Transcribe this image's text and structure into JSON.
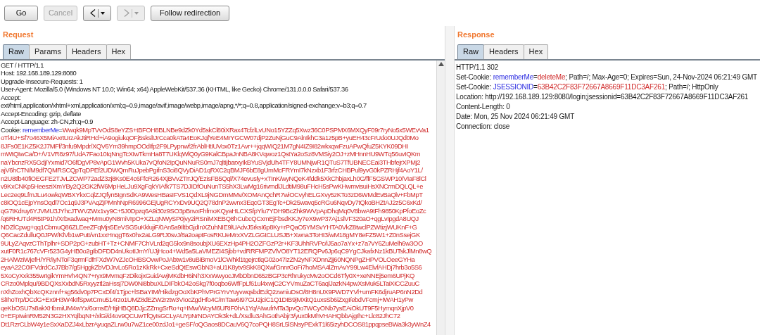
{
  "toolbar": [
    {
      "kind": "text",
      "label": "Go",
      "disabled": false
    },
    {
      "kind": "text",
      "label": "Cancel",
      "disabled": true
    },
    {
      "kind": "back",
      "disabled": false
    },
    {
      "kind": "forward",
      "disabled": true
    },
    {
      "kind": "text",
      "label": "Follow redirection",
      "disabled": false
    }
  ],
  "request": {
    "title": "Request",
    "tabs": [
      {
        "label": "Raw",
        "selected": true
      },
      {
        "label": "Params",
        "selected": false
      },
      {
        "label": "Headers",
        "selected": false
      },
      {
        "label": "Hex",
        "selected": false
      }
    ],
    "lines": [
      [
        {
          "kind": "plain",
          "text": "GET / HTTP/1.1"
        }
      ],
      [
        {
          "kind": "plain",
          "text": "Host: 192.168.189.129:8080"
        }
      ],
      [
        {
          "kind": "plain",
          "text": "Upgrade-Insecure-Requests: 1"
        }
      ],
      [
        {
          "kind": "plain",
          "text": "User-Agent: Mozilla/5.0 (Windows NT 10.0; Win64; x64) AppleWebKit/537.36 (KHTML, like Gecko) Chrome/131.0.0.0 Safari/537.36"
        }
      ],
      [
        {
          "kind": "plain",
          "text": "Accept:"
        }
      ],
      [
        {
          "kind": "plain",
          "text": "ext/html,application/xhtml+xml,application/xml;q=0.9,image/avif,image/webp,image/apng,*/*;q=0.8,application/signed-exchange;v=b3;q=0.7"
        }
      ],
      [
        {
          "kind": "plain",
          "text": "Accept-Encoding: gzip, deflate"
        }
      ],
      [
        {
          "kind": "plain",
          "text": "Accept-Language: zh-CN,zh;q=0.9"
        }
      ],
      [
        {
          "kind": "plain",
          "text": "Cookie: "
        },
        {
          "kind": "name",
          "text": "rememberMe"
        },
        {
          "kind": "plain",
          "text": "="
        },
        {
          "kind": "value",
          "text": "Wwqk9MpTVvOdS8eYZS+tBFOH8BLNBe9dZk0Yd5skCl80iXRax4TcfzlLvUNo15YZZq5Xwz36C0PSPMX6MXQyF09r7ryNo5x5WEvVa1"
        }
      ],
      [
        {
          "kind": "value",
          "text": "oTl4U+Sf7o46X5MiAxrtUrzAkJtiRHcl+iA9ogiukqOFj5skslIJrCca0kATa4EoKJqfYeE4MrYGCW07djP2ZuNjGuC9AlnIkhC3a1z5pB+yuEH43cFrUdo0UJQd0Mo"
        }
      ],
      [
        {
          "kind": "value",
          "text": "8JFs0E1KZ5K2J7MFf/3nfu9Mpdr/XQV6Ym39hmpOOdIfp2F9LPypnwf2frAblHtIUVox0Tz1Avr++jqqWIQ21M7gN4IZ9I82wkxqwFzuAPwQfuZ5KYK09DHI"
        }
      ],
      [
        {
          "kind": "value",
          "text": "mWtQIwCa/D+/V1VR8z97/UdA7Fao10IqNngTcXIwTkmHa8T7UKlqWlQ0yG9KalCBpaJnNBA8KVqwoz1QstYa2oSz8VMSiy2OJ+zMHnnHU9WTq56uvIQKm"
        }
      ],
      [
        {
          "kind": "value",
          "text": "naYbcnzRX5Gdj/Yxmid7O6fDgVP8vApG1Wvh5KUka7vQfoN2IpQuNNuRS0mJ7qltIjbarxyIkBYuSVjdUh4TFY8UMNjwR1QTuS7TfUBNECEai3THbfejrXPMj2"
        }
      ],
      [
        {
          "kind": "value",
          "text": "ajV6hCTN/M9df7QMRSCQpTqDPEf2UDWQmRuJpebPgifnS3ci8QVyDiAD1qRXC2qBMJF6bE8gUmMcFRYmI7kNzxb1F3rfzCHBPul9yvG0kPZRHjf4AoY1L/"
        }
      ],
      [
        {
          "kind": "value",
          "text": "n2U8tlb40fiOEGFE2TJvLZCWP72adZ3zj8Ks0E4c6FfcR264XjBVvZTrrJQ/EzisFB5Qql/X74evusly+xTInK/wyNQeK4fddk5XkChbjaxLh0G/flF5GSWP10/VIaF8lCl"
        }
      ],
      [
        {
          "kind": "value",
          "text": "v9KxCNKp5HeesziXmYBy2Q2GK2fW6MpHeLJu9XgFqkYIAfk7TS7DJIDfOuNunTS5hX3LwMg16rivmdlJLdtiM98uFHcH5sPwKHwmvisuiHsXNCrmDQLQL+e"
        }
      ],
      [
        {
          "kind": "value",
          "text": "Lec2eq9LfrnJLu4owkqWBXYkxCqlZJQfyn5IgnSdKA9WesHBasIFVS1QdXL9jNGDmMMv/XOMAnQchR7wiOCvyhELGXvy5zKTo3zD6WMdEvBaQlv+FbMpT"
        }
      ],
      [
        {
          "kind": "value",
          "text": "c8iOQ1cEjpYnsOqdl7Oc1q9J3PVAqZjPMnhNpR6996GEjUgRCYxDv9UQ2Q78dnP2wvnx3EqcGT3EgTc+Dk25wavq5cRGu6NqvDy7tQkoBHZtAJ2z5C6xKd/"
        }
      ],
      [
        {
          "kind": "value",
          "text": "qG7tKdruy6YJVMU3JYhcJTWVZWx1vy9C+5J0Dpzq6A9i30z9SO3pBnvxFhfmoKQyaHLCXSfpYlu7YDH9BcZhk9WVpApDhqMq0V8bwA9tFh9850KpPfoEoZc"
        }
      ],
      [
        {
          "kind": "value",
          "text": "/q6RHUTd4R5tP91h/Xrbxadwaq+Mmu0yN8miVrpO+XZLqNWySP0jvy2iRSniMXEBQ8hCubcQCxmEjFbsdKKJy7eX9wP37Aj1slVF320aO+qgLvIpgdA8UQJ"
        }
      ],
      [
        {
          "kind": "value",
          "text": "NDZlCpwg+qq1CbmuQ86ZLEeeZFqMjs5EeVSG5uKklujiF/0An5a9IltbGjdInXZuhNIE9lUAdvJ5rksI6p8Ky+rPQaO5YMSvYHTA0VkZ8twclPZWtizjWUKnF+G"
        }
      ],
      [
        {
          "kind": "value",
          "text": "Q6CacZdulluQ0JPW/KlVb1wPutt/vn1xxHnqgT6x0hx2aLG9RJ0svJ/8a2oaptFosRKUeMrxXVZLGGtCLUSJB+Xwna3ToHI3/wM18gMY8eFZ5W1+Z0nSsejGK"
        }
      ],
      [
        {
          "kind": "value",
          "text": "9ULyZAqvzCThTplhr+SDP2pG+zubHT+Tz+CNMF7ChVLrd2qG5kx9n8soubjXU6EXzHp4PH2OZFGzP2r+KF3UhhRVPc/iJ5ao7aYx+z7a7vY6ZuMelh6w3OO"
        }
      ],
      [
        {
          "kind": "value",
          "text": "xutF0R1c767cVFr523G4yHB0o2gIbDFDD4nUkotIJmY/UJjHco4+Wd5a5LaVMEZI4Sjbb+vdRRFMPZVlVO8YT12ERQPv6Jp6qC9YgCJkafxNz1kBUTskJlMn8wQ"
        }
      ],
      [
        {
          "kind": "value",
          "text": "2HAlWziWjefH/YR/iyNToF3qrmFdfrFXdW7vZJcOHBSOvwPoJAbtw1v8uBiBmoV1lCWhkl1tgejrctlqG02o47izZN2yNFXDnnZjj60NQNPgZHPVOLOeeGYHa"
        }
      ],
      [
        {
          "kind": "value",
          "text": "eyaA22C0IFVdrdCcJ7Bb7/g5HggkZbVDJrvLo5Ro1zKkRk+CxeSdQtEswGbN3+aU1K8ytv9SkK8QXwfGnnrGoFi7hoMSA4lZmAvY99Lw4ElvfAHDj7hrb3o5S6"
        }
      ],
      [
        {
          "kind": "value",
          "text": "5XoCyXxk355wrIgikYmHvh4QN7+ryx9MvmqFzDikojxGuidAwjMKdbH6iNh3XxWwyocJMbDbnD65zBGP3cRhrukycMv2oOCd6Tfy0X+xeNNEj5em6UPjKQ"
        }
      ],
      [
        {
          "kind": "value",
          "text": "CRzo0Mplqu/9BDQXsXxbdN5Rxyyztl2aHssj7DW0Ni8bbuXLDIFbkO42oSkg7f0oqbo6WfFpLf61ul4xwjC2CYVmuZaCT6aqlJazkN4pwXsMuk5LTaiXiCCZuuC"
        }
      ],
      [
        {
          "kind": "value",
          "text": "nXhZoxhQbXcQKznnf+sg56dv0p7PCxDf4/1Tjpc+lSBaYIM/HikdzgOoXbKPhVPrGYrvYuyvwqsbdEdQ2zwniuDsO/8H8nUX9PWD7YVl+umFK6djruAP6nN2Dd"
        }
      ],
      [
        {
          "kind": "value",
          "text": "SlIhoTrp/DCdG+Ex9H3W4kIfSpwtCmu514rzo1UMZ8dEZW2rztw3VIocZgdHfo4C/mTaw6I97GU2jciC1Q1DIB9jMXitQ1uxsSb6iZxgI/ebdVFcmj+IWAH1yPw"
        }
      ],
      [
        {
          "kind": "value",
          "text": "qeKbOSU7s8akXHbmiUM4wYx/6omsE/HtjiHBQ8DJjcZZmgSrRo+q+IMw/WcyM6URIF0hA1Yq/AIwufrMTa3pvQo7WCyONb7ysEAiOkUT9F5HymqnXjpV0"
        }
      ],
      [
        {
          "kind": "value",
          "text": "0+EFpIwinRM52N3G2HXYqlbqNI+/xlGi/d4ov9QCUwTfQyIsGCLyAUYpNrNDAYOk3k+dL/Xsdlu3AhGothAbjr3/yux0kMhVHAHQbbAjgIhc+Llc82JhC72"
        }
      ],
      [
        {
          "kind": "value",
          "text": "Dt1RzrCLbW4y1eSxXaDZJ4xLbzrAyuqaZLrw0u7wZ1ce00zdJo1+geSF/oQGaos8DCauV6Q7coPQH8SrL5lSNsyPExkT1l65izyhDCOS81ppqpseBWa3k3yWnZ4"
        }
      ]
    ]
  },
  "response": {
    "title": "Response",
    "tabs": [
      {
        "label": "Raw",
        "selected": true
      },
      {
        "label": "Headers",
        "selected": false
      },
      {
        "label": "Hex",
        "selected": false
      }
    ],
    "lines": [
      [
        {
          "kind": "plain",
          "text": "HTTP/1.1 302"
        }
      ],
      [
        {
          "kind": "plain",
          "text": "Set-Cookie: "
        },
        {
          "kind": "name",
          "text": "rememberMe"
        },
        {
          "kind": "plain",
          "text": "="
        },
        {
          "kind": "value",
          "text": "deleteMe"
        },
        {
          "kind": "plain",
          "text": "; Path=/; Max-Age=0; Expires=Sun, 24-Nov-2024 06:21:49 GMT"
        }
      ],
      [
        {
          "kind": "plain",
          "text": "Set-Cookie: "
        },
        {
          "kind": "name",
          "text": "JSESSIONID"
        },
        {
          "kind": "plain",
          "text": "="
        },
        {
          "kind": "value",
          "text": "63B42C2F83F72667A8669F11DC3AF261"
        },
        {
          "kind": "plain",
          "text": "; Path=/; HttpOnly"
        }
      ],
      [
        {
          "kind": "plain",
          "text": "Location: http://192.168.189.129:8080/login;jsessionid=63B42C2F83F72667A8669F11DC3AF261"
        }
      ],
      [
        {
          "kind": "plain",
          "text": "Content-Length: 0"
        }
      ],
      [
        {
          "kind": "plain",
          "text": "Date: Mon, 25 Nov 2024 06:21:49 GMT"
        }
      ],
      [
        {
          "kind": "plain",
          "text": "Connection: close"
        }
      ]
    ]
  }
}
